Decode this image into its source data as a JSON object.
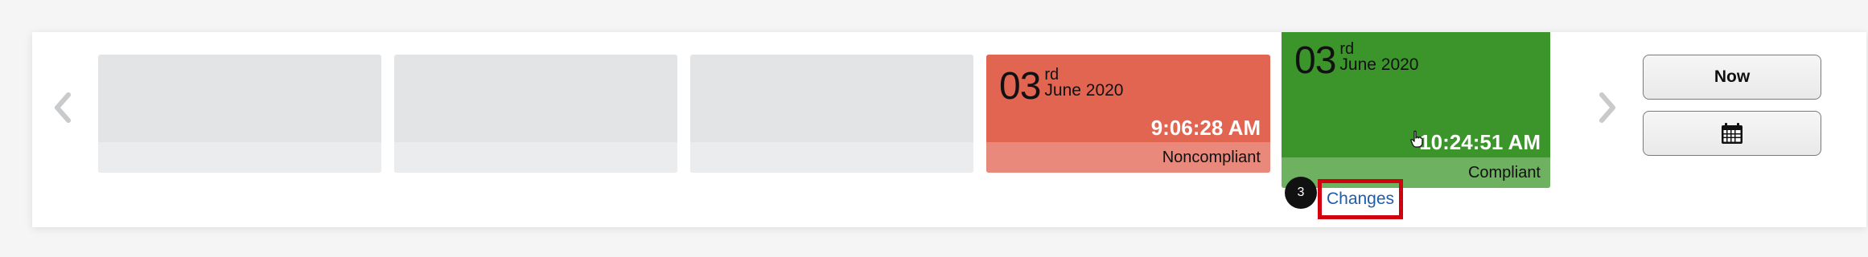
{
  "navigation": {
    "prev_icon": "chevron-left-icon",
    "next_icon": "chevron-right-icon"
  },
  "timeline": {
    "cards": [
      {
        "state": "empty"
      },
      {
        "state": "empty"
      },
      {
        "state": "empty"
      },
      {
        "state": "noncompliant",
        "day": "03",
        "suffix": "rd",
        "month_year": "June 2020",
        "time": "9:06:28 AM",
        "status": "Noncompliant",
        "color": "#e26552"
      },
      {
        "state": "compliant",
        "selected": true,
        "day": "03",
        "suffix": "rd",
        "month_year": "June 2020",
        "time": "10:24:51 AM",
        "status": "Compliant",
        "color": "#3c952b"
      }
    ]
  },
  "changes": {
    "count": "3",
    "label": "Changes",
    "highlight_color": "#d0000f"
  },
  "buttons": {
    "now_label": "Now",
    "calendar_icon": "calendar-icon"
  }
}
